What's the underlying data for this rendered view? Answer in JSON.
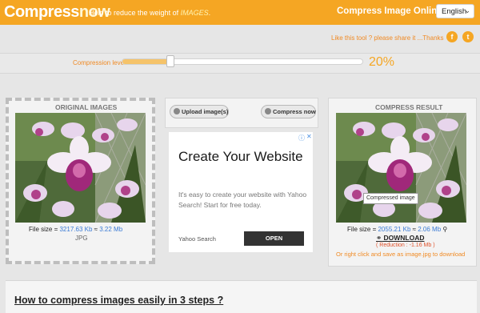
{
  "header": {
    "logo_main": "Compress",
    "logo_accent": "now",
    "tagline_prefix": "Help to reduce the weight of ",
    "tagline_highlight": "IMAGES",
    "tagline_suffix": ".",
    "title": "Compress Image Online",
    "language": "English"
  },
  "share": {
    "text": "Like this tool ? please share it ...Thanks",
    "icons": [
      "facebook-icon",
      "twitter-icon"
    ]
  },
  "compression": {
    "label": "Compression level",
    "value_text": "20%",
    "level_fraction": 0.2
  },
  "original": {
    "title": "ORIGINAL IMAGES",
    "size_prefix": "File size = ",
    "size_kb": "3217.63 Kb",
    "size_sep": " ≈ ",
    "size_mb": "3.22 Mb",
    "format": "JPG"
  },
  "actions": {
    "upload_label": "Upload image(s)",
    "compress_label": "Compress now"
  },
  "ad": {
    "headline": "Create Your Website",
    "body": "It's easy to create your website with Yahoo Search! Start for free today.",
    "brand": "Yahoo Search",
    "cta": "OPEN"
  },
  "result": {
    "title": "COMPRESS RESULT",
    "tooltip": "Compressed image",
    "size_prefix": "File size = ",
    "size_kb": "2055.21 Kb",
    "size_sep": " ≈ ",
    "size_mb": "2.06 Mb",
    "download_label": "DOWNLOAD",
    "reduction": "( Reduction : -1.16 Mb )",
    "right_click_text": "Or right click and save as image.jpg to download"
  },
  "bottom": {
    "title": "How to compress images easily in 3 steps ?"
  },
  "colors": {
    "accent": "#f5a623",
    "link_blue": "#3a7bd5",
    "orange_text": "#f08a24"
  }
}
